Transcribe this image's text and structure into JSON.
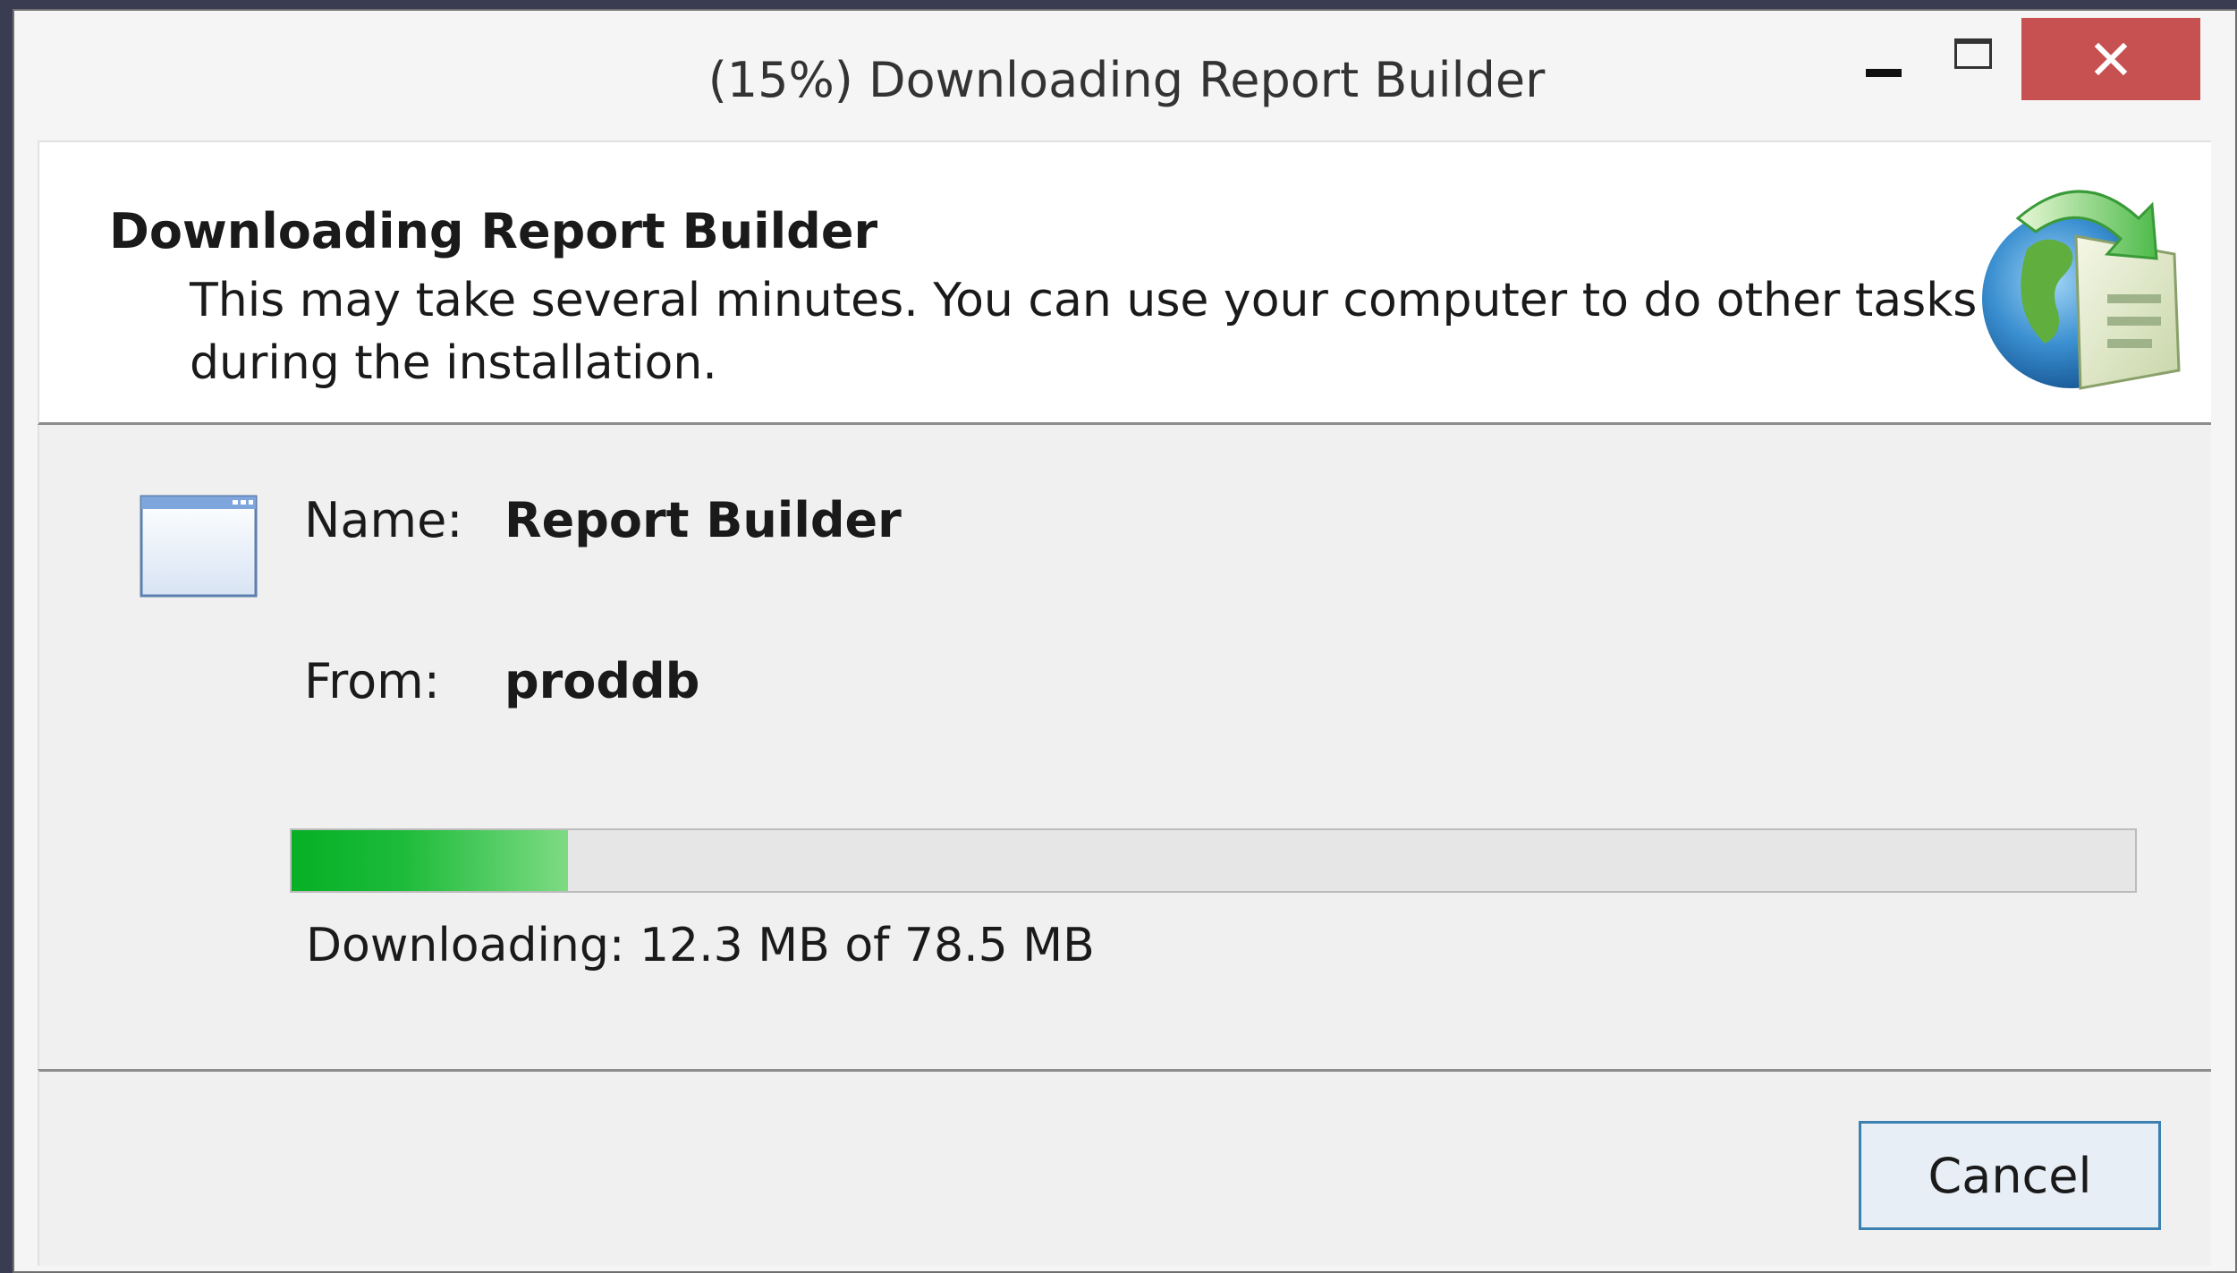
{
  "window": {
    "title": "(15%) Downloading Report Builder"
  },
  "header": {
    "title": "Downloading Report Builder",
    "description": "This may take several minutes. You can use your computer to do other tasks during the installation."
  },
  "details": {
    "name_label": "Name:",
    "name_value": "Report Builder",
    "from_label": "From:",
    "from_value": "proddb"
  },
  "progress": {
    "percent": 15,
    "status": "Downloading: 12.3 MB of 78.5 MB"
  },
  "footer": {
    "cancel_label": "Cancel"
  },
  "icons": {
    "header": "globe-download-icon",
    "app": "application-window-icon",
    "minimize": "minimize-icon",
    "maximize": "maximize-icon",
    "close": "close-icon"
  },
  "colors": {
    "close_button": "#c75050",
    "progress_fill": "#06b025",
    "cancel_border": "#3c7fb1"
  }
}
